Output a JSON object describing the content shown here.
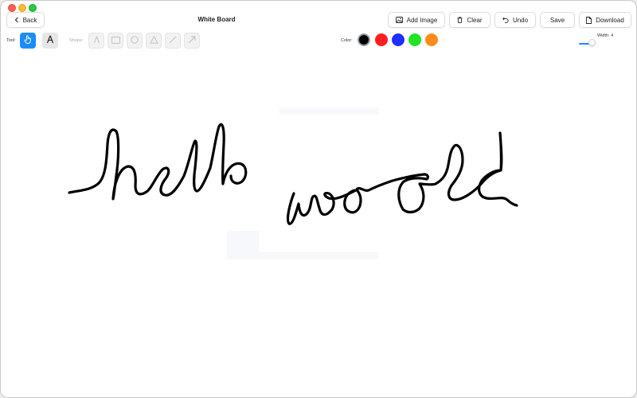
{
  "window": {
    "title": "White Board"
  },
  "toolbar": {
    "back_label": "Back",
    "add_image_label": "Add Image",
    "clear_label": "Clear",
    "undo_label": "Undo",
    "save_label": "Save",
    "download_label": "Download"
  },
  "tools": {
    "tool_label": "Tool:",
    "items": [
      {
        "name": "pointer",
        "icon": "hand-pointer-icon",
        "active": true
      },
      {
        "name": "pen",
        "icon": "pen-icon",
        "active": false
      }
    ]
  },
  "shapes": {
    "label": "Shape:",
    "items": [
      "pen-shape-icon",
      "rectangle-icon",
      "circle-icon",
      "triangle-icon",
      "line-icon",
      "arrow-icon"
    ]
  },
  "colors": {
    "label": "Color:",
    "swatches": [
      "#000000",
      "#ff1f1f",
      "#1f2fff",
      "#22e322",
      "#ff8c1a"
    ],
    "selected": "#000000"
  },
  "width": {
    "label": "Width: 4",
    "value": 4
  }
}
